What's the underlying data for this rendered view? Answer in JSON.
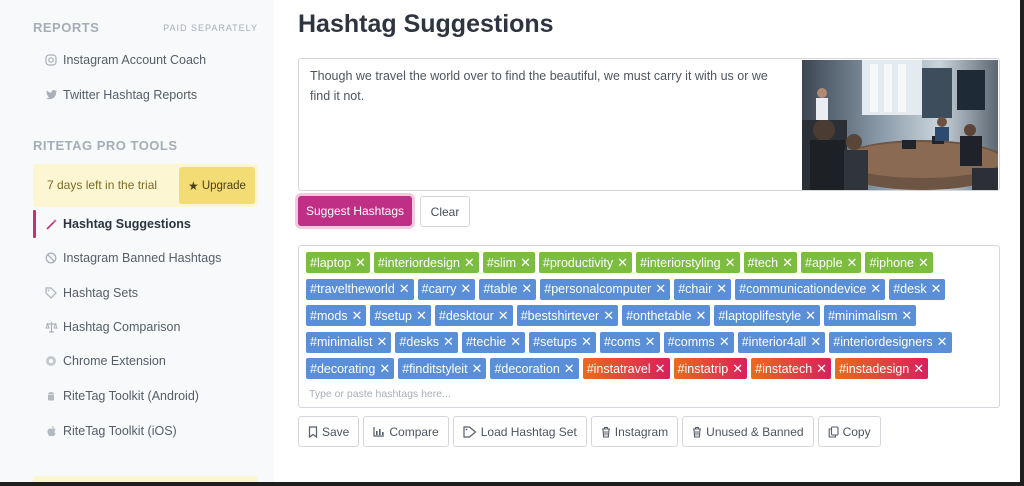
{
  "sidebar": {
    "reports_title": "REPORTS",
    "reports_note": "PAID SEPARATELY",
    "reports_items": [
      {
        "label": "Instagram Account Coach",
        "icon": "instagram-icon"
      },
      {
        "label": "Twitter Hashtag Reports",
        "icon": "twitter-icon"
      }
    ],
    "pro_title": "RITETAG PRO TOOLS",
    "trial_text": "7 days left in the trial",
    "upgrade_label": "Upgrade",
    "tools": [
      {
        "label": "Hashtag Suggestions",
        "icon": "magic-wand-icon",
        "active": true
      },
      {
        "label": "Instagram Banned Hashtags",
        "icon": "ban-icon"
      },
      {
        "label": "Hashtag Sets",
        "icon": "tags-icon"
      },
      {
        "label": "Hashtag Comparison",
        "icon": "balance-scale-icon"
      },
      {
        "label": "Chrome Extension",
        "icon": "chrome-icon"
      },
      {
        "label": "RiteTag Toolkit (Android)",
        "icon": "android-icon"
      },
      {
        "label": "RiteTag Toolkit (iOS)",
        "icon": "apple-icon"
      }
    ]
  },
  "main": {
    "title": "Hashtag Suggestions",
    "input_text": "Though we travel the world over to find the beautiful, we must carry it with us or we find it not.",
    "suggest_label": "Suggest Hashtags",
    "clear_label": "Clear",
    "tag_placeholder": "Type or paste hashtags here...",
    "tag_rows": [
      [
        {
          "text": "#laptop",
          "color": "green"
        },
        {
          "text": "#interiordesign",
          "color": "green"
        },
        {
          "text": "#slim",
          "color": "green"
        },
        {
          "text": "#productivity",
          "color": "green"
        },
        {
          "text": "#interiorstyling",
          "color": "green"
        },
        {
          "text": "#tech",
          "color": "green"
        },
        {
          "text": "#apple",
          "color": "green"
        },
        {
          "text": "#iphone",
          "color": "green"
        }
      ],
      [
        {
          "text": "#traveltheworld",
          "color": "blue"
        },
        {
          "text": "#carry",
          "color": "blue"
        },
        {
          "text": "#table",
          "color": "blue"
        },
        {
          "text": "#personalcomputer",
          "color": "blue"
        },
        {
          "text": "#chair",
          "color": "blue"
        },
        {
          "text": "#communicationdevice",
          "color": "blue"
        },
        {
          "text": "#desk",
          "color": "blue"
        }
      ],
      [
        {
          "text": "#mods",
          "color": "blue"
        },
        {
          "text": "#setup",
          "color": "blue"
        },
        {
          "text": "#desktour",
          "color": "blue"
        },
        {
          "text": "#bestshirtever",
          "color": "blue"
        },
        {
          "text": "#onthetable",
          "color": "blue"
        },
        {
          "text": "#laptoplifestyle",
          "color": "blue"
        },
        {
          "text": "#minimalism",
          "color": "blue"
        }
      ],
      [
        {
          "text": "#minimalist",
          "color": "blue"
        },
        {
          "text": "#desks",
          "color": "blue"
        },
        {
          "text": "#techie",
          "color": "blue"
        },
        {
          "text": "#setups",
          "color": "blue"
        },
        {
          "text": "#coms",
          "color": "blue"
        },
        {
          "text": "#comms",
          "color": "blue"
        },
        {
          "text": "#interior4all",
          "color": "blue"
        },
        {
          "text": "#interiordesigners",
          "color": "blue"
        }
      ],
      [
        {
          "text": "#decorating",
          "color": "blue"
        },
        {
          "text": "#finditstyleit",
          "color": "blue"
        },
        {
          "text": "#decoration",
          "color": "blue"
        },
        {
          "text": "#instatravel",
          "color": "orange"
        },
        {
          "text": "#instatrip",
          "color": "orange"
        },
        {
          "text": "#instatech",
          "color": "orange"
        },
        {
          "text": "#instadesign",
          "color": "orange"
        }
      ]
    ],
    "toolbar": [
      {
        "label": "Save",
        "icon": "bookmark-icon"
      },
      {
        "label": "Compare",
        "icon": "bar-chart-icon"
      },
      {
        "label": "Load Hashtag Set",
        "icon": "tag-icon"
      },
      {
        "label": "Instagram",
        "icon": "trash-icon"
      },
      {
        "label": "Unused & Banned",
        "icon": "trash-icon"
      },
      {
        "label": "Copy",
        "icon": "copy-icon"
      }
    ]
  },
  "colors": {
    "accent": "#c02f86",
    "tag_green": "#7cbd3f",
    "tag_blue": "#5a8fd8",
    "tag_orange_start": "#ea6a1f",
    "tag_orange_end": "#d8205d",
    "trial_bg": "#fdf6d2",
    "upgrade_bg": "#f3dc74"
  }
}
